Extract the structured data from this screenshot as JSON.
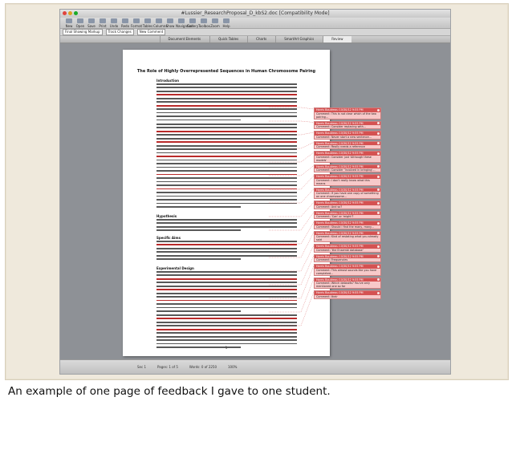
{
  "window": {
    "title": "#Lussier_ResearchProposal_D_kbS2.doc [Compatibility Mode]"
  },
  "toolbar": {
    "items": [
      "New",
      "Open",
      "Save",
      "Print",
      "Undo",
      "Redo",
      "Format",
      "Tables",
      "Columns",
      "Show",
      "Navigation",
      "Gallery",
      "Toolbox",
      "Zoom",
      "Help"
    ]
  },
  "formatbar": {
    "view": "Final Showing Markup",
    "track_label": "Track Changes",
    "new_comment": "New Comment"
  },
  "ribbon": {
    "tabs": [
      "Document Elements",
      "Quick Tables",
      "Charts",
      "SmartArt Graphics",
      "Review"
    ],
    "active": 4
  },
  "document": {
    "title": "The Role of Highly Overrepresented Sequences in Human Chromosome Pairing",
    "headings": {
      "intro": "Introduction",
      "hypothesis": "Hypothesis",
      "aims": "Specific Aims",
      "design": "Experimental Design"
    },
    "page_number": "1"
  },
  "comments": [
    {
      "author": "Harris Boudreau 10/30/12 9:55 PM",
      "text": "Comment: This is not clear which of the two pairing..."
    },
    {
      "author": "Harris Boudreau 10/30/12 9:55 PM",
      "text": "Comment: Consider replacing with..."
    },
    {
      "author": "Harris Boudreau 10/30/12 9:55 PM",
      "text": "Comment: Never start a new sentence..."
    },
    {
      "author": "Harris Boudreau 10/30/12 9:55 PM",
      "text": "Comment: Really needs a reference"
    },
    {
      "author": "Harris Boudreau 10/30/12 9:55 PM",
      "text": "Comment: Consider just 'Although these models'"
    },
    {
      "author": "Harris Boudreau 10/30/12 9:55 PM",
      "text": "Comment: Consider 'involved in bringing'..."
    },
    {
      "author": "Harris Boudreau 10/30/12 9:55 PM",
      "text": "Comment: I don't really know what this means"
    },
    {
      "author": "Harris Boudreau 10/30/12 9:55 PM",
      "text": "Comment: If you have one copy of something on one chromosome..."
    },
    {
      "author": "Harris Boudreau 10/30/12 9:55 PM",
      "text": "Comment: And so?"
    },
    {
      "author": "Harris Boudreau 10/30/12 9:55 PM",
      "text": "Comment: 'Can' or 'might'?"
    },
    {
      "author": "Harris Boudreau 10/30/12 9:55 PM",
      "text": "Comment: Should I find the many, many..."
    },
    {
      "author": "Harris Boudreau 10/30/12 9:55 PM",
      "text": "Comment: Kind of restating what you already said"
    },
    {
      "author": "Harris Boudreau 10/30/12 9:55 PM",
      "text": "Comment: 'the Ensembl database'"
    },
    {
      "author": "Harris Boudreau 10/30/12 9:55 PM",
      "text": "Comment: Frequencies"
    },
    {
      "author": "Harris Boudreau 10/30/12 9:55 PM",
      "text": "Comment: This almost sounds like you have completed..."
    },
    {
      "author": "Harris Boudreau 10/30/12 9:55 PM",
      "text": "Comment: Which datasets? You've only mentioned one so far"
    },
    {
      "author": "Harris Boudreau 10/30/12 9:55 PM",
      "text": "Comment: their"
    }
  ],
  "statusbar": {
    "section": "Sec 1",
    "pages": "Pages: 1 of 5",
    "words": "Words: 0 of 2250",
    "zoom": "100%"
  },
  "caption": "An example of one page of feedback I gave to one student.",
  "colors": {
    "frame_bg": "#efe9dc",
    "comment_bg": "#f7c9c9",
    "comment_head": "#d55252",
    "markup_red": "#b92a2a"
  }
}
